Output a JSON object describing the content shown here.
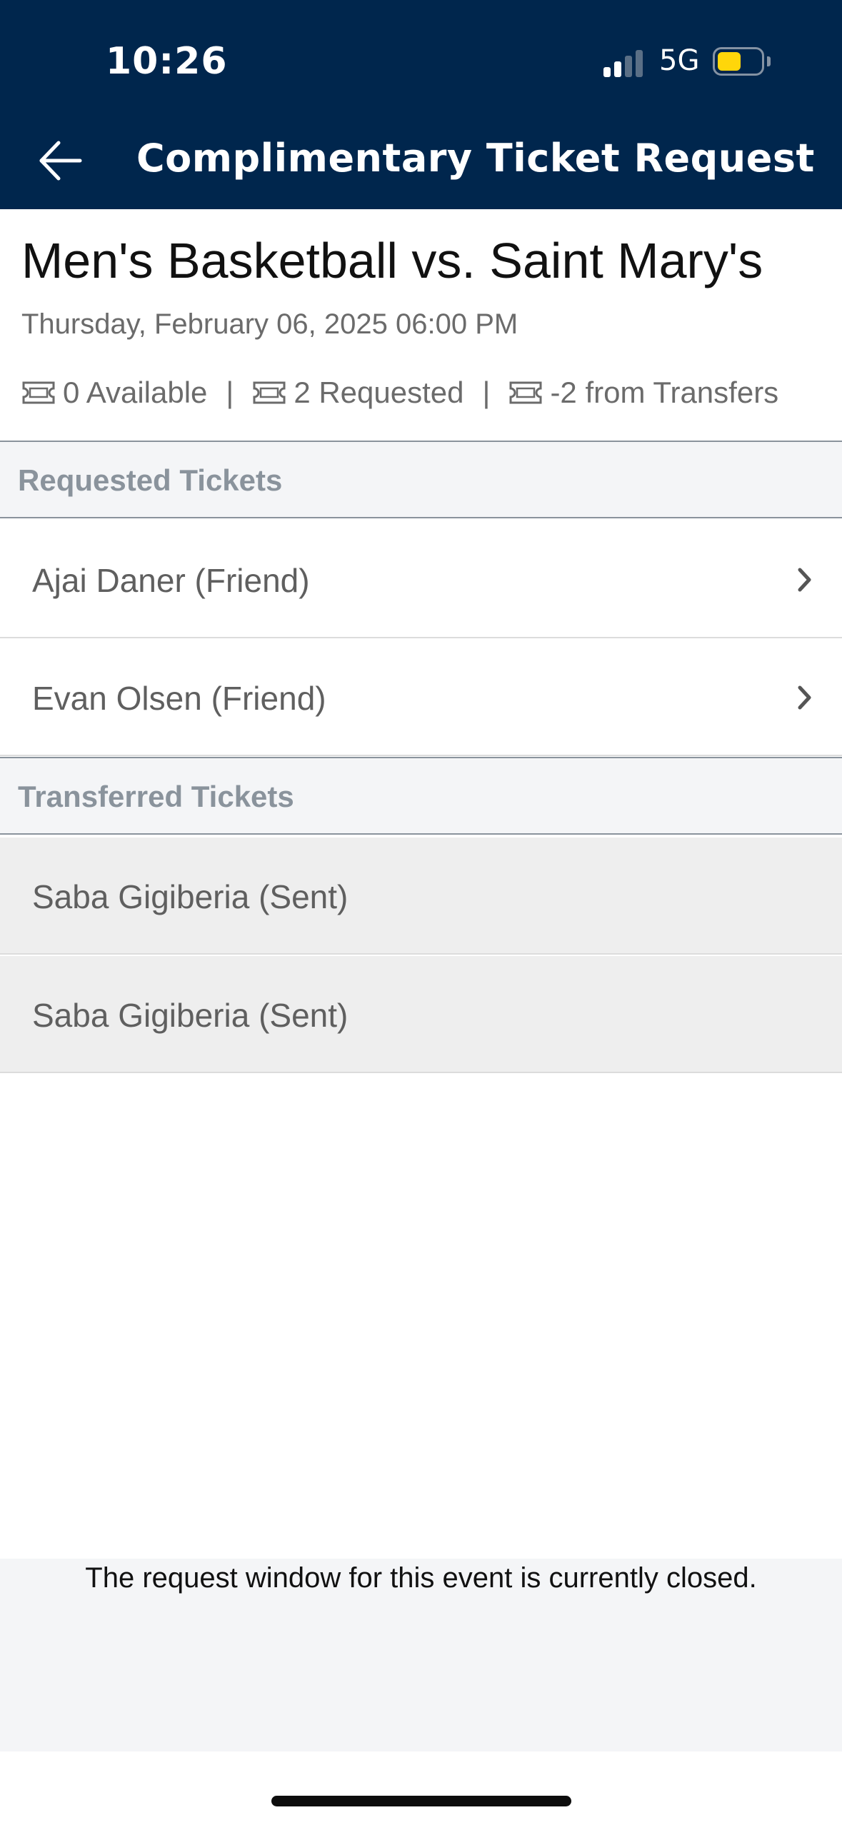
{
  "status_bar": {
    "time": "10:26",
    "network": "5G"
  },
  "header": {
    "title": "Complimentary Ticket Request",
    "back_icon": "arrow-left-icon"
  },
  "event": {
    "title": "Men's Basketball vs. Saint Mary's",
    "datetime": "Thursday, February 06, 2025 06:00 PM",
    "stats": [
      {
        "icon": "ticket-icon",
        "text": "0 Available"
      },
      {
        "icon": "ticket-icon",
        "text": "2 Requested"
      },
      {
        "icon": "ticket-icon",
        "text": "-2 from Transfers"
      }
    ],
    "separator": "|"
  },
  "requested": {
    "heading": "Requested Tickets",
    "items": [
      {
        "label": "Ajai Daner (Friend)",
        "icon": "chevron-right-icon"
      },
      {
        "label": "Evan Olsen (Friend)",
        "icon": "chevron-right-icon"
      }
    ]
  },
  "transferred": {
    "heading": "Transferred Tickets",
    "items": [
      {
        "label": "Saba Gigiberia (Sent)"
      },
      {
        "label": "Saba Gigiberia (Sent)"
      }
    ]
  },
  "footer": {
    "message": "The request window for this event is currently closed."
  },
  "colors": {
    "header_bg": "#00264d",
    "section_text": "#8a939c",
    "battery_fill": "#ffd60a"
  }
}
